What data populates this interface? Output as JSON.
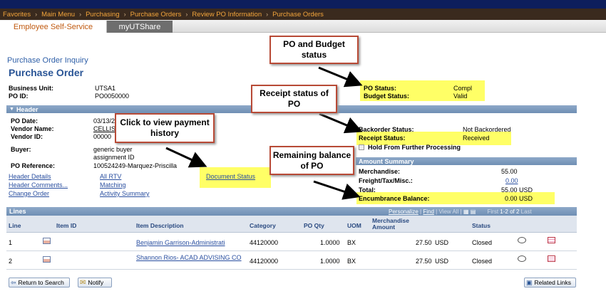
{
  "nav": {
    "items": [
      "Favorites",
      "Main Menu",
      "Purchasing",
      "Purchase Orders",
      "Review PO Information",
      "Purchase Orders"
    ],
    "separator": "›"
  },
  "tabs": {
    "ess": "Employee Self-Service",
    "utshare": "myUTShare"
  },
  "page": {
    "breadcrumb": "Purchase Order Inquiry",
    "title": "Purchase Order"
  },
  "summary": {
    "business_unit_label": "Business Unit:",
    "business_unit": "UTSA1",
    "po_id_label": "PO ID:",
    "po_id": "PO0050000",
    "po_status_label": "PO Status:",
    "po_status": "Compl",
    "budget_status_label": "Budget Status:",
    "budget_status": "Valid"
  },
  "header": {
    "section_label": "Header",
    "po_date_label": "PO Date:",
    "po_date": "03/13/2",
    "vendor_name_label": "Vendor Name:",
    "vendor_name": "CELLIS",
    "vendor_id_label": "Vendor ID:",
    "vendor_id": "00000",
    "buyer_label": "Buyer:",
    "buyer_line1": "generic buyer",
    "buyer_line2": "assignment ID",
    "po_reference_label": "PO Reference:",
    "po_reference": "100524249-Marquez-Priscilla",
    "backorder_label": "Backorder Status:",
    "backorder": "Not Backordered",
    "receipt_label": "Receipt Status:",
    "receipt": "Received",
    "hold_label": "Hold From Further Processing"
  },
  "links": {
    "header_details": "Header Details",
    "header_comments": "Header Comments...",
    "change_order": "Change Order",
    "all_rtv": "All RTV",
    "matching": "Matching",
    "activity_summary": "Activity Summary",
    "document_status": "Document Status"
  },
  "amount": {
    "section_label": "Amount Summary",
    "merchandise_label": "Merchandise:",
    "merchandise": "55.00",
    "freight_label": "Freight/Tax/Misc.:",
    "freight": "0.00",
    "total_label": "Total:",
    "total": "55.00 USD",
    "encumbrance_label": "Encumbrance Balance:",
    "encumbrance": "0.00 USD"
  },
  "lines": {
    "section_label": "Lines",
    "personalize": "Personalize",
    "find": "Find",
    "view_all": "View All",
    "first": "First",
    "range": "1-2 of 2",
    "last": "Last",
    "columns": [
      "Line",
      "Item ID",
      "Item Description",
      "Category",
      "PO Qty",
      "UOM",
      "Merchandise Amount",
      "Status"
    ],
    "rows": [
      {
        "line": "1",
        "description": "Benjamin Garrison-Administrati",
        "category": "44120000",
        "qty": "1.0000",
        "uom": "BX",
        "amount": "27.50",
        "currency": "USD",
        "status": "Closed"
      },
      {
        "line": "2",
        "description": "Shannon Rios- ACAD ADVISING CO",
        "category": "44120000",
        "qty": "1.0000",
        "uom": "BX",
        "amount": "27.50",
        "currency": "USD",
        "status": "Closed"
      }
    ]
  },
  "buttons": {
    "return": "Return to Search",
    "notify": "Notify",
    "related": "Related Links"
  },
  "callouts": {
    "po_budget": "PO and Budget status",
    "receipt": "Receipt status of PO",
    "payment": "Click to view payment history",
    "remaining": "Remaining balance of PO"
  },
  "colors": {
    "highlight": "#ffff66",
    "callout_border": "#b84a36",
    "nav_text": "#f3a53c",
    "link": "#2a4fa0"
  }
}
